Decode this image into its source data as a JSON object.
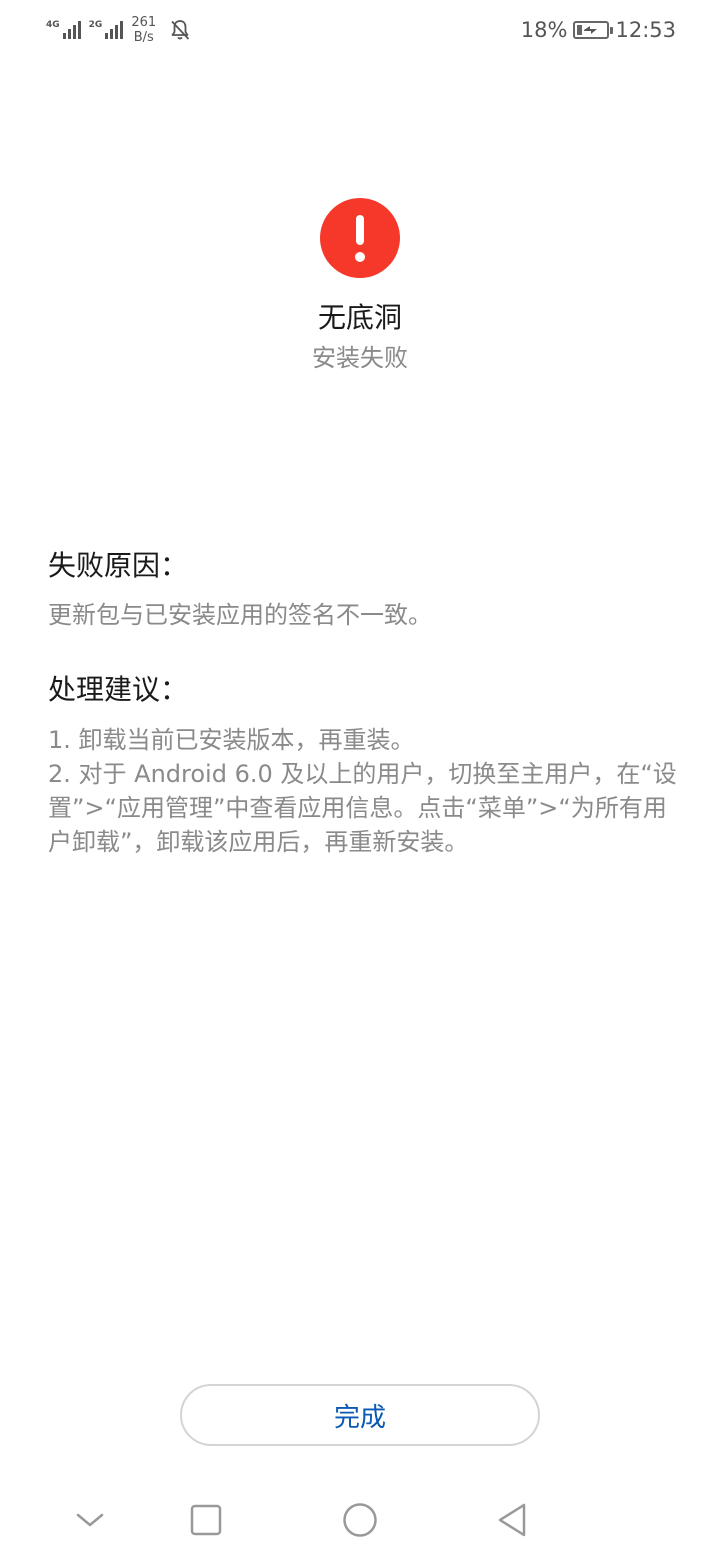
{
  "status_bar": {
    "network_1": "4G",
    "network_2": "2G",
    "speed_value": "261",
    "speed_unit": "B/s",
    "battery_percent": "18%",
    "battery_level": 0.18,
    "time": "12:53"
  },
  "header": {
    "app_name": "无底洞",
    "status": "安装失败"
  },
  "failure_reason": {
    "title": "失败原因：",
    "text": "更新包与已安装应用的签名不一致。"
  },
  "suggestions": {
    "title": "处理建议：",
    "items": [
      "1. 卸载当前已安装版本，再重装。",
      "2. 对于 Android 6.0 及以上的用户，切换至主用户，在“设置”>“应用管理”中查看应用信息。点击“菜单”>“为所有用户卸载”，卸载该应用后，再重新安装。"
    ]
  },
  "actions": {
    "done_label": "完成"
  },
  "colors": {
    "error_red": "#f5382a",
    "accent_blue": "#0a59b5",
    "secondary_text": "#8a8a8a"
  },
  "nav_bar": {
    "icons": [
      "chevron-down-icon",
      "square-icon",
      "circle-icon",
      "back-triangle-icon"
    ]
  }
}
